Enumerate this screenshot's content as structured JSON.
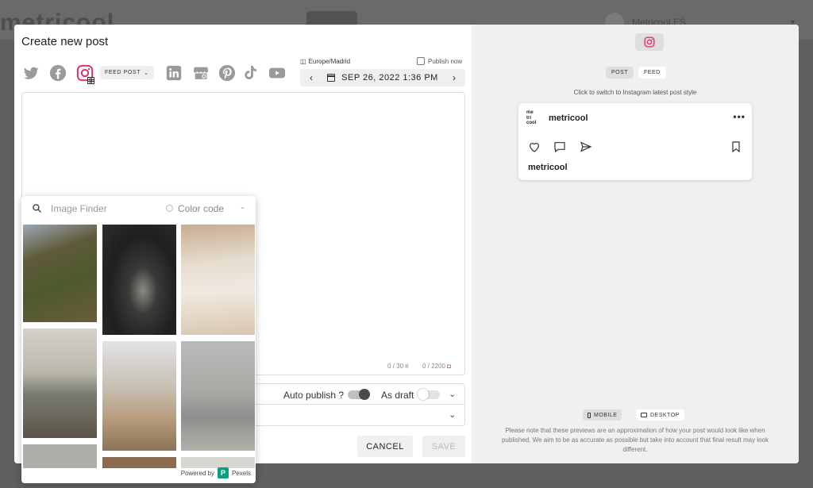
{
  "background": {
    "logo": "metricool",
    "account": "Metricool ES"
  },
  "modal": {
    "title": "Create new post"
  },
  "networks": [
    {
      "name": "twitter-icon"
    },
    {
      "name": "facebook-icon"
    },
    {
      "name": "instagram-icon",
      "active": true
    },
    {
      "name": "linkedin-icon"
    },
    {
      "name": "google-business-icon"
    },
    {
      "name": "pinterest-icon"
    },
    {
      "name": "tiktok-icon"
    },
    {
      "name": "youtube-icon"
    }
  ],
  "post_type": {
    "value": "FEED POST"
  },
  "schedule": {
    "timezone": "Europe/Madrid",
    "publish_now": "Publish now",
    "datetime": "SEP 26, 2022 1:36 PM"
  },
  "editor": {
    "hashtag_count": "0 / 30",
    "char_count": "0 / 2200"
  },
  "options": {
    "auto_publish": "Auto publish ?",
    "as_draft": "As draft"
  },
  "actions": {
    "cancel": "CANCEL",
    "save": "SAVE"
  },
  "image_finder": {
    "placeholder": "Image Finder",
    "color_code": "Color code",
    "powered_by": "Powered by",
    "provider": "Pexels",
    "photos": [
      {
        "desc": "mossy cliffs",
        "color": "#5a5c3a"
      },
      {
        "desc": "car side mirror dark",
        "color": "#2b2b2b"
      },
      {
        "desc": "woman white knit sweater",
        "color": "#d9c9b4"
      },
      {
        "desc": "sea at sunset",
        "color": "#9a968a"
      },
      {
        "desc": "woman in white on beach",
        "color": "#b9ab98"
      },
      {
        "desc": "man standing in sea",
        "color": "#a5a6a0"
      },
      {
        "desc": "grey photo",
        "color": "#b0aea8"
      },
      {
        "desc": "brown photo",
        "color": "#8a6b50"
      },
      {
        "desc": "light photo",
        "color": "#d8d6d0"
      }
    ]
  },
  "preview": {
    "tabs": [
      "POST",
      "FEED"
    ],
    "hint": "Click to switch to Instagram latest post style",
    "logo_text": [
      "me",
      "tri",
      "cool"
    ],
    "username": "metricool",
    "caption": "metricool",
    "devices": [
      "MOBILE",
      "DESKTOP"
    ],
    "note": "Please note that these previews are an approximation of how your post would look like when published. We aim to be as accurate as possible but take into account that final result may look different."
  },
  "colors": {
    "instagram": "#e1306c",
    "icon_grey": "#9a9a9a",
    "pexels": "#07a081"
  }
}
